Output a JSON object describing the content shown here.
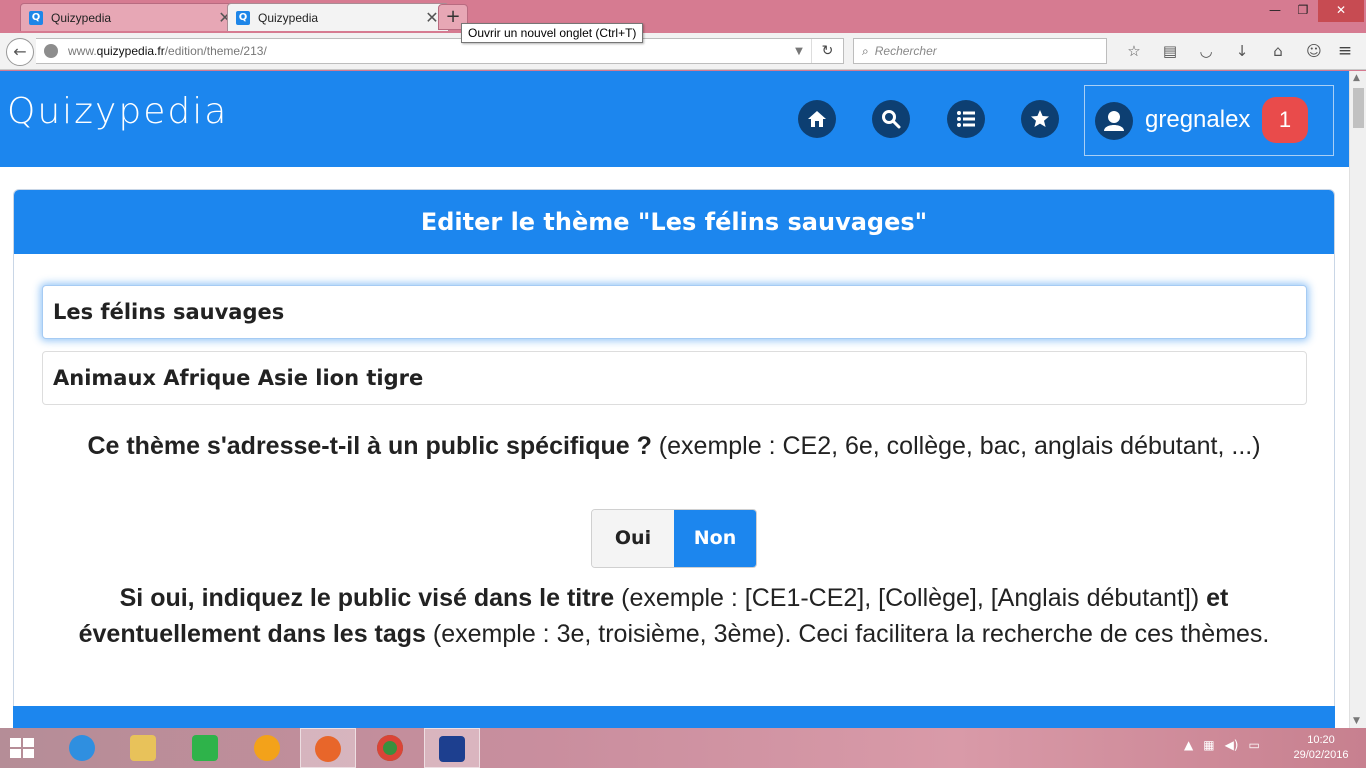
{
  "browser": {
    "tabs": [
      {
        "label": "Quizypedia",
        "favicon": "Q"
      },
      {
        "label": "Quizypedia",
        "favicon": "Q"
      }
    ],
    "new_tab_tooltip": "Ouvrir un nouvel onglet (Ctrl+T)",
    "url_prefix": "www.",
    "url_domain": "quizypedia.fr",
    "url_path": "/edition/theme/213/",
    "search_placeholder": "Rechercher",
    "icons": [
      "star-icon",
      "reading-list-icon",
      "pocket-icon",
      "download-icon",
      "home-icon",
      "chat-icon",
      "hamburger-menu-icon"
    ]
  },
  "site": {
    "logo": "Quizypedia",
    "username": "gregnalex",
    "notification_count": "1"
  },
  "editor": {
    "title": "Editer le thème \"Les félins sauvages\"",
    "theme_name_value": "Les félins sauvages",
    "tags_value": "Animaux Afrique Asie lion tigre",
    "question_bold": "Ce thème s'adresse-t-il à un public spécifique ?",
    "question_rest": " (exemple : CE2, 6e, collège, bac, anglais débutant, ...)",
    "toggle": {
      "yes": "Oui",
      "no": "Non",
      "selected": "Non"
    },
    "info_bold_1": "Si oui, indiquez le public visé dans le titre",
    "info_rest_1": " (exemple : [CE1-CE2], [Collège], [Anglais débutant]) ",
    "info_bold_2": "et éventuellement dans les tags",
    "info_rest_2": " (exemple : 3e, troisième, 3ème). Ceci facilitera la recherche de ces thèmes."
  },
  "taskbar": {
    "time": "10:20",
    "date": "29/02/2016"
  },
  "colors": {
    "brand_blue": "#1c86ee",
    "dark_circle": "#0d3f72",
    "badge_red": "#e94b4b"
  }
}
